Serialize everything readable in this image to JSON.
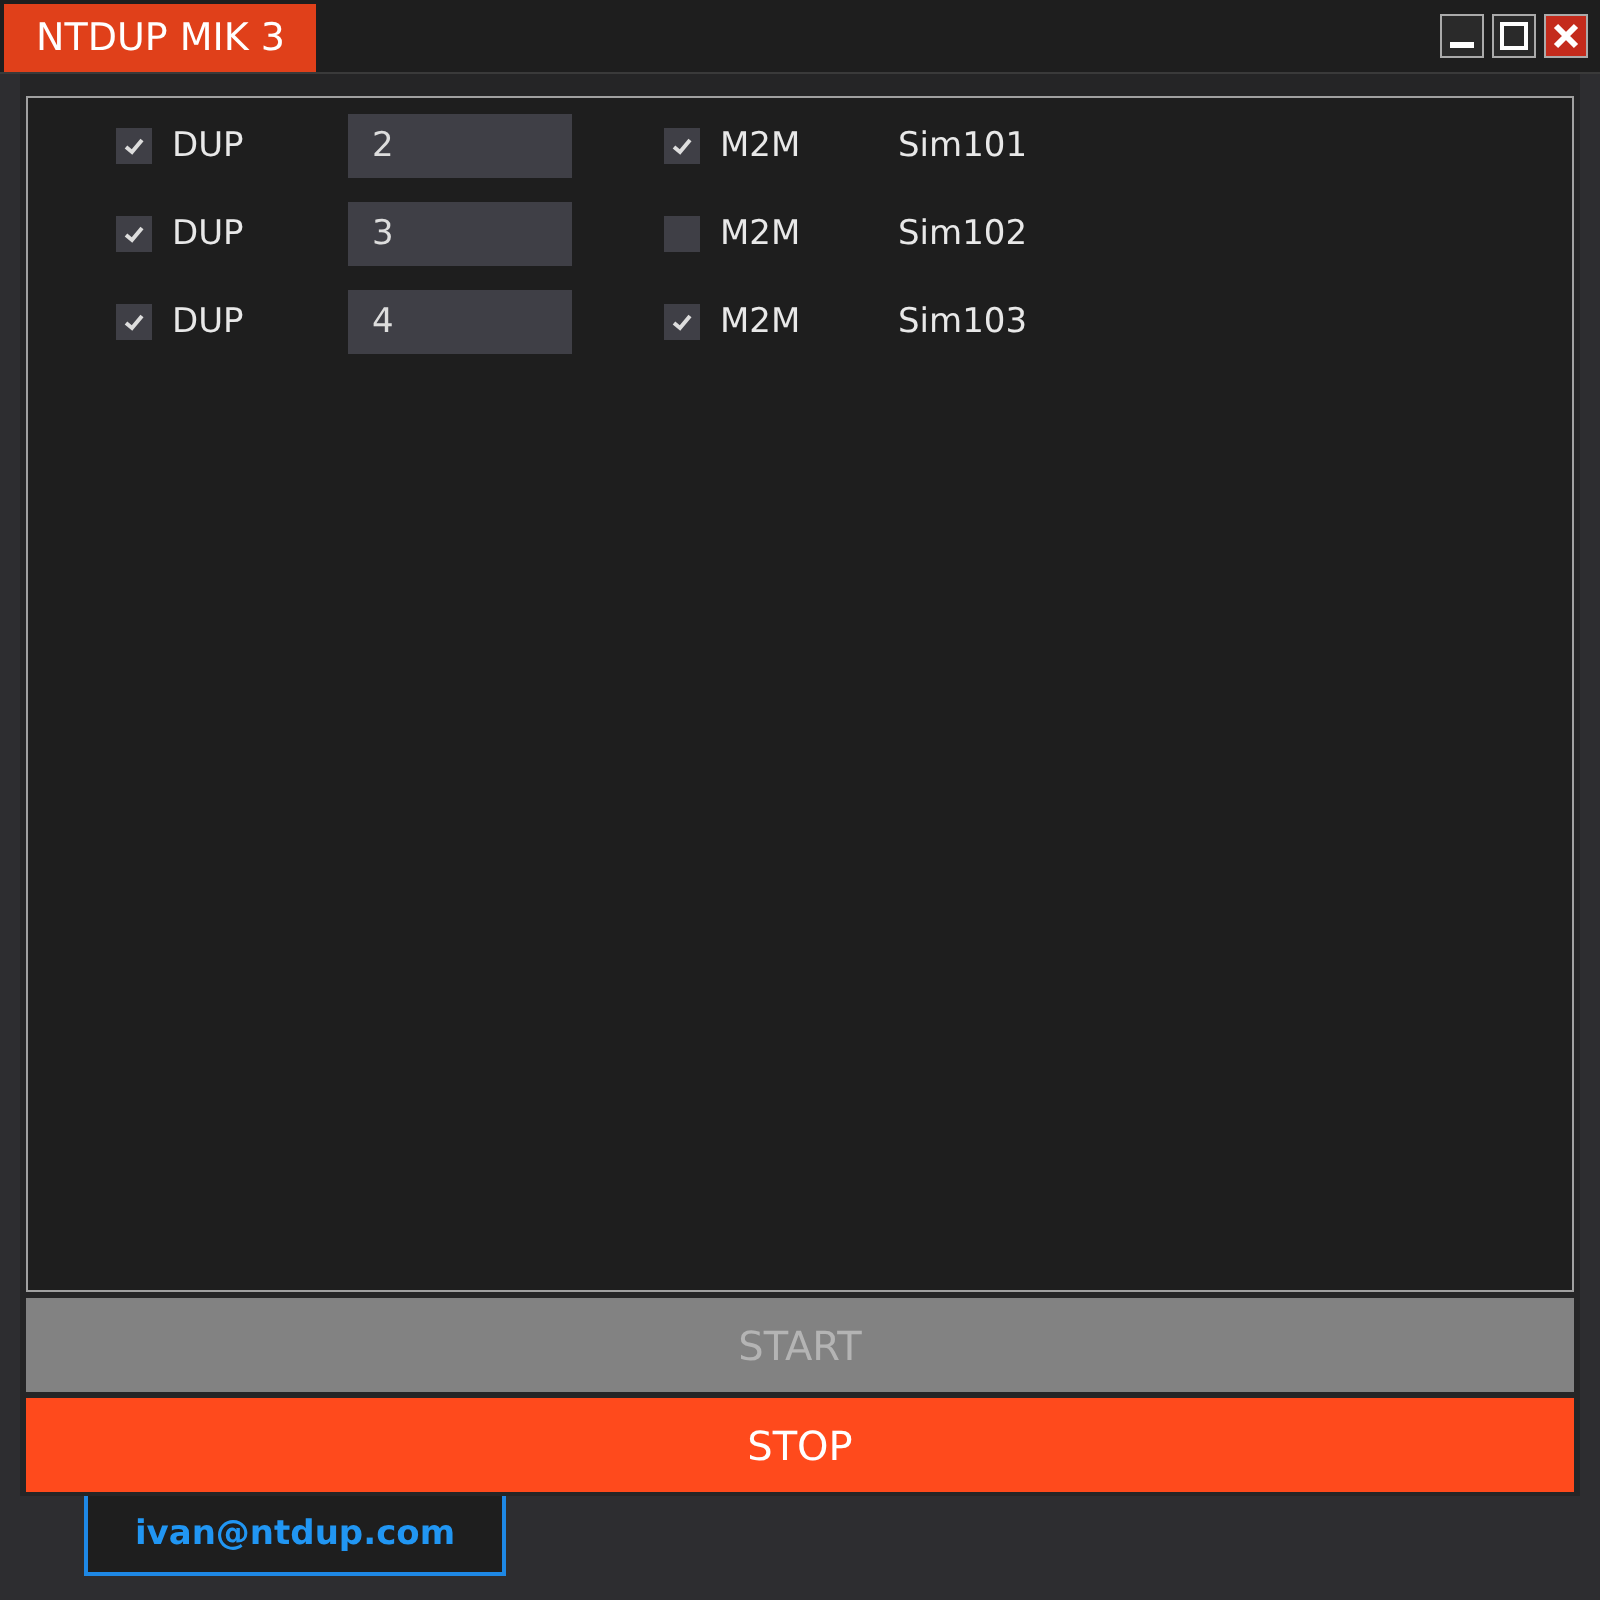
{
  "window": {
    "title": "NTDUP MIK 3"
  },
  "rows": [
    {
      "dup": {
        "label": "DUP",
        "checked": true
      },
      "value": "2",
      "m2m": {
        "label": "M2M",
        "checked": true
      },
      "sim": "Sim101"
    },
    {
      "dup": {
        "label": "DUP",
        "checked": true
      },
      "value": "3",
      "m2m": {
        "label": "M2M",
        "checked": false
      },
      "sim": "Sim102"
    },
    {
      "dup": {
        "label": "DUP",
        "checked": true
      },
      "value": "4",
      "m2m": {
        "label": "M2M",
        "checked": true
      },
      "sim": "Sim103"
    }
  ],
  "buttons": [
    {
      "label": "START",
      "disabled": true,
      "kind": "start"
    },
    {
      "label": "STOP",
      "disabled": false,
      "kind": "stop"
    }
  ],
  "footer": {
    "email": "ivan@ntdup.com"
  }
}
